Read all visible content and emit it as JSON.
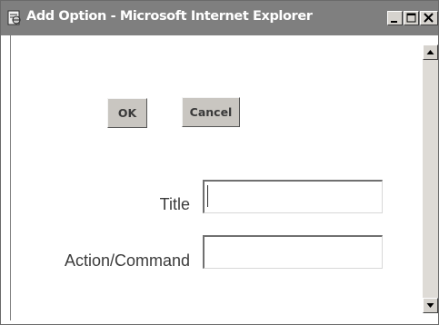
{
  "window": {
    "title": "Add Option - Microsoft Internet Explorer",
    "icon": "ie-page-icon"
  },
  "titlebar_buttons": {
    "minimize_icon": "minimize-icon",
    "maximize_icon": "maximize-icon",
    "close_icon": "close-icon"
  },
  "scrollbar": {
    "up_icon": "arrow-up-icon",
    "down_icon": "arrow-down-icon"
  },
  "buttons": {
    "ok_label": "OK",
    "cancel_label": "Cancel"
  },
  "form": {
    "title_label": "Title",
    "title_value": "",
    "action_label": "Action/Command",
    "action_value": ""
  },
  "colors": {
    "titlebar": "#7f7f7f",
    "button_face": "#c9c6c1"
  }
}
